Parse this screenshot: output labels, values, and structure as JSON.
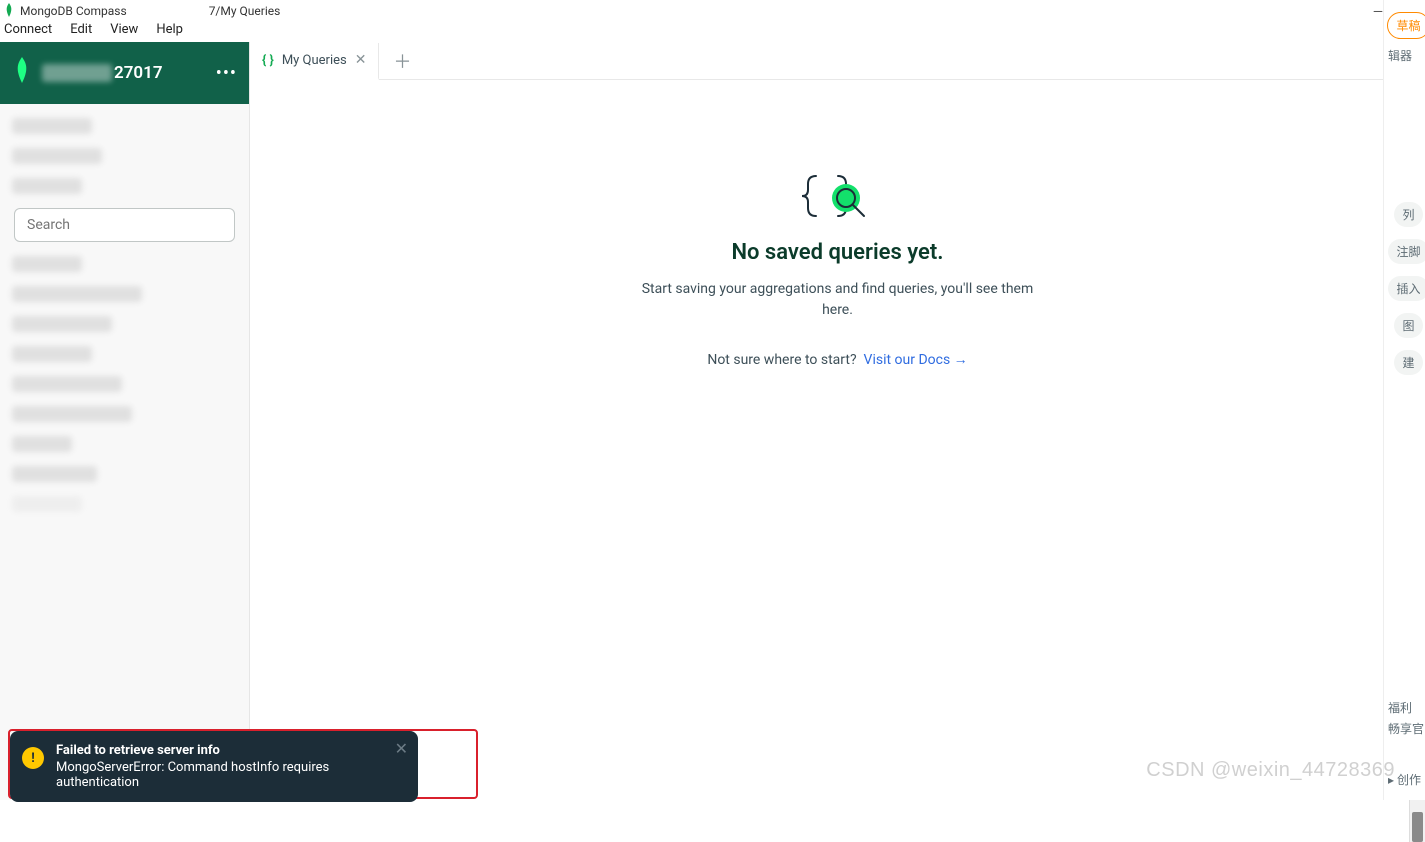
{
  "window": {
    "app_name": "MongoDB Compass",
    "path_suffix": "7/My Queries"
  },
  "menu": [
    "Connect",
    "Edit",
    "View",
    "Help"
  ],
  "connection": {
    "port_suffix": "27017"
  },
  "search": {
    "placeholder": "Search"
  },
  "tab": {
    "label": "My Queries"
  },
  "empty_state": {
    "title": "No saved queries yet.",
    "desc": "Start saving your aggregations and find queries, you'll see them here.",
    "hint_text": "Not sure where to start?",
    "link_text": "Visit our Docs →"
  },
  "toast": {
    "title": "Failed to retrieve server info",
    "message": "MongoServerError: Command hostInfo requires authentication"
  },
  "right_strip": {
    "top_pill": "草稿",
    "items": [
      "辑器",
      "列",
      "注脚",
      "插入",
      "图",
      "建"
    ],
    "fuli": "福利",
    "chang": "畅享官",
    "chuangzuo": "▸ 创作"
  },
  "watermark": "CSDN @weixin_44728369"
}
